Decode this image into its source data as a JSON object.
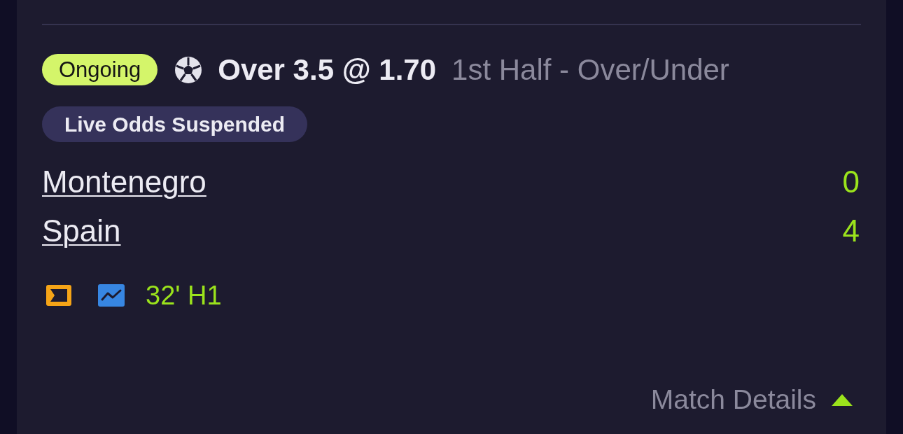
{
  "status_badge": {
    "label": "Ongoing"
  },
  "bet": {
    "selection": "Over 3.5 @ 1.70",
    "market": "1st Half - Over/Under"
  },
  "notice": {
    "label": "Live Odds Suspended"
  },
  "teams": [
    {
      "name": "Montenegro",
      "score": "0"
    },
    {
      "name": "Spain",
      "score": "4"
    }
  ],
  "match_clock": "32' H1",
  "details_toggle": {
    "label": "Match Details",
    "expanded": true
  }
}
